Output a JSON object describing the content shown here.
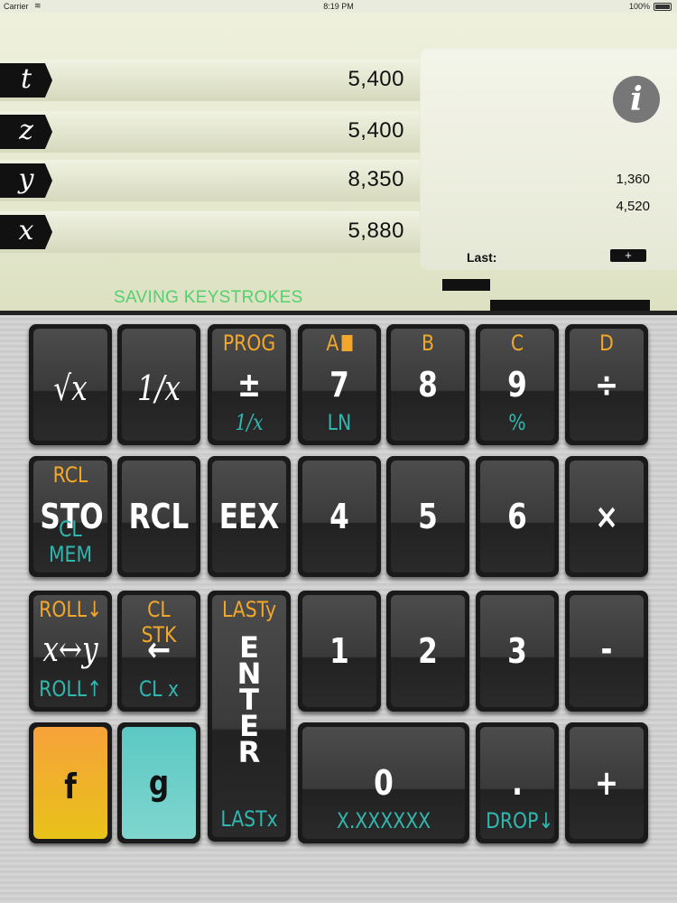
{
  "status_bar": {
    "carrier": "Carrier",
    "time": "8:19 PM",
    "battery": "100%"
  },
  "stack": [
    {
      "reg": "t",
      "value": "5,400"
    },
    {
      "reg": "z",
      "value": "5,400"
    },
    {
      "reg": "y",
      "value": "8,350"
    },
    {
      "reg": "x",
      "value": "5,880"
    }
  ],
  "info_icon": "i",
  "memory_values": [
    "1,360",
    "4,520"
  ],
  "last_label": "Last:",
  "last_op": "+",
  "mode_text": "SAVING KEYSTROKES",
  "colors": {
    "shift_f": "#f2a72a",
    "shift_g": "#2fb7b0",
    "mode_text": "#55d06e"
  },
  "keys": {
    "sqrt": {
      "main": "√x"
    },
    "recip": {
      "main": "1/x"
    },
    "chs": {
      "top": "PROG",
      "main": "±",
      "bot": "1/x"
    },
    "k7": {
      "top": "A",
      "main": "7",
      "bot": "LN"
    },
    "k8": {
      "top": "B",
      "main": "8"
    },
    "k9": {
      "top": "C",
      "main": "9",
      "bot": "%"
    },
    "div": {
      "top": "D",
      "main": "÷"
    },
    "sto": {
      "top": "RCL",
      "main": "STO",
      "bot": "CL MEM"
    },
    "rcl": {
      "main": "RCL"
    },
    "eex": {
      "main": "EEX"
    },
    "k4": {
      "main": "4"
    },
    "k5": {
      "main": "5"
    },
    "k6": {
      "main": "6"
    },
    "mul": {
      "main": "×"
    },
    "swap": {
      "top": "ROLL↓",
      "main": "x↔y",
      "bot": "ROLL↑"
    },
    "back": {
      "top": "CL STK",
      "main": "←",
      "bot": "CL x"
    },
    "enter": {
      "top": "LASTy",
      "letters": "E N T E R",
      "bot": "LASTx"
    },
    "k1": {
      "main": "1"
    },
    "k2": {
      "main": "2"
    },
    "k3": {
      "main": "3"
    },
    "sub": {
      "main": "-"
    },
    "f": {
      "main": "f"
    },
    "g": {
      "main": "g"
    },
    "k0": {
      "main": "0",
      "bot": "X.XXXXXX"
    },
    "dot": {
      "main": ".",
      "bot": "DROP↓"
    },
    "add": {
      "main": "+"
    }
  }
}
